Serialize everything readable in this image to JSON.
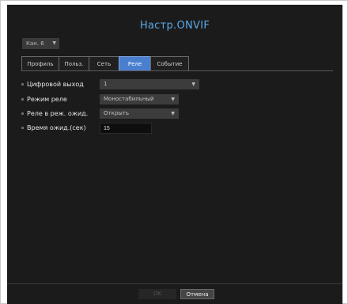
{
  "dialog": {
    "title": "Настр.ONVIF"
  },
  "channel": {
    "selected": "Кан. 6",
    "caret_icon": "chevron-down-icon"
  },
  "tabs": [
    {
      "label": "Профиль",
      "active": false
    },
    {
      "label": "Польз.",
      "active": false
    },
    {
      "label": "Сеть",
      "active": false
    },
    {
      "label": "Реле",
      "active": true
    },
    {
      "label": "Событие",
      "active": false
    }
  ],
  "settings": {
    "digital_output": {
      "label": "Цифровой выход",
      "value": "1"
    },
    "relay_mode": {
      "label": "Режим реле",
      "value": "Моностабильный"
    },
    "relay_idle": {
      "label": "Реле в реж. ожид.",
      "value": "Открыть"
    },
    "wait_time": {
      "label": "Время ожид.(сек)",
      "value": "15"
    }
  },
  "buttons": {
    "ok_label": "OK",
    "ok_enabled": false,
    "cancel_label": "Отмена"
  },
  "colors": {
    "title": "#5aa8e8",
    "active_tab": "#4a7fd0",
    "background": "#1b1b1b"
  }
}
